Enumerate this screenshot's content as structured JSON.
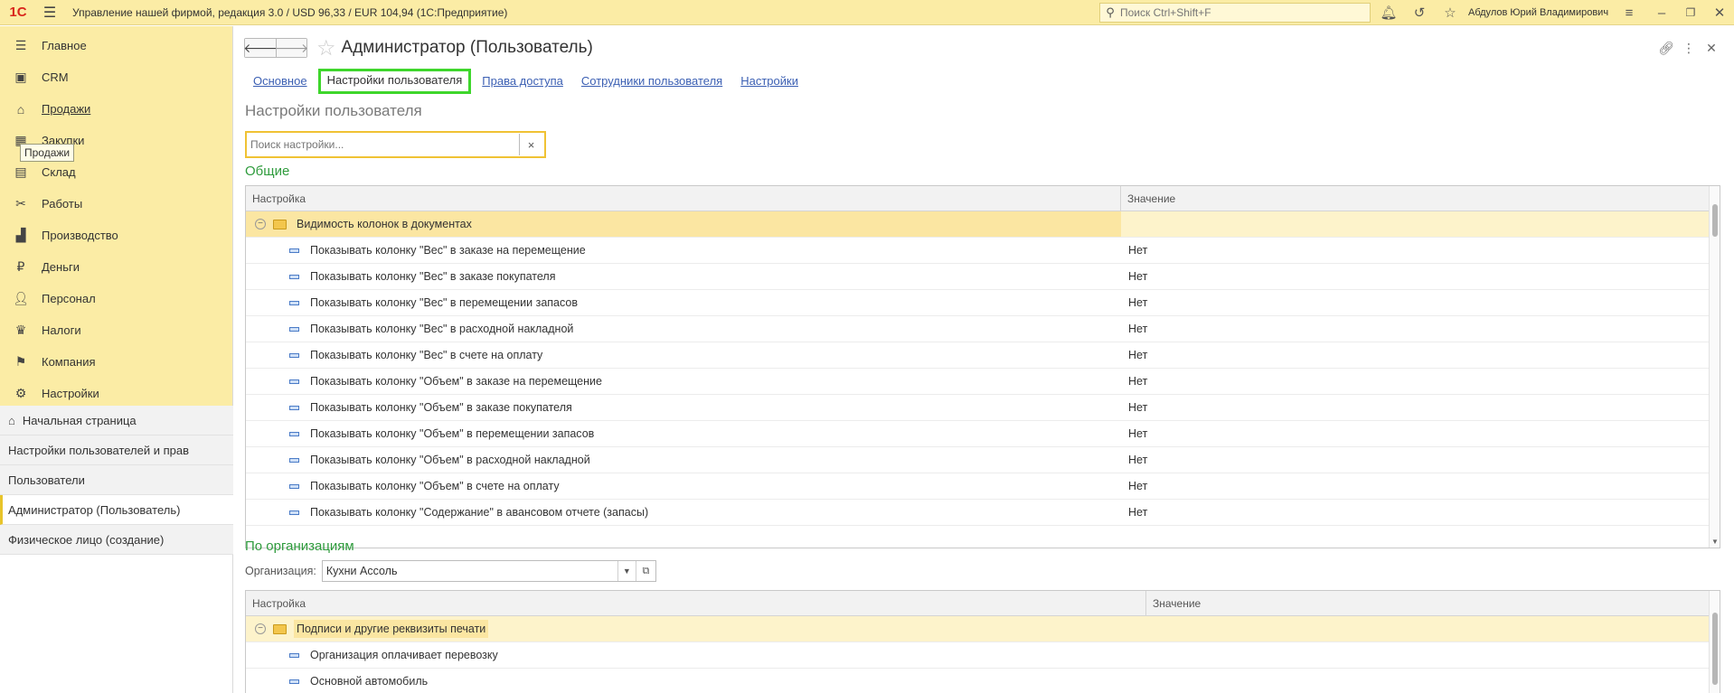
{
  "topbar": {
    "logo": "1С",
    "title": "Управление нашей фирмой, редакция 3.0 / USD 96,33 / EUR 104,94  (1С:Предприятие)",
    "search_placeholder": "Поиск Ctrl+Shift+F",
    "user": "Абдулов Юрий Владимирович"
  },
  "sidebar": {
    "sections": [
      {
        "label": "Главное",
        "icon": "menu-icon"
      },
      {
        "label": "CRM",
        "icon": "crm-icon"
      },
      {
        "label": "Продажи",
        "icon": "sales-icon"
      },
      {
        "label": "Закупки",
        "icon": "purchases-icon"
      },
      {
        "label": "Склад",
        "icon": "warehouse-icon"
      },
      {
        "label": "Работы",
        "icon": "tools-icon"
      },
      {
        "label": "Производство",
        "icon": "factory-icon"
      },
      {
        "label": "Деньги",
        "icon": "money-icon"
      },
      {
        "label": "Персонал",
        "icon": "people-icon"
      },
      {
        "label": "Налоги",
        "icon": "eagle-icon"
      },
      {
        "label": "Компания",
        "icon": "flag-icon"
      },
      {
        "label": "Настройки",
        "icon": "gear-icon"
      }
    ],
    "tooltip": "Продажи",
    "open_windows": [
      {
        "label": "Начальная страница"
      },
      {
        "label": "Настройки пользователей и прав"
      },
      {
        "label": "Пользователи"
      },
      {
        "label": "Администратор (Пользователь)"
      },
      {
        "label": "Физическое лицо (создание)"
      }
    ]
  },
  "form": {
    "title": "Администратор (Пользователь)",
    "tabs": [
      {
        "label": "Основное"
      },
      {
        "label": "Настройки пользователя"
      },
      {
        "label": "Права доступа"
      },
      {
        "label": "Сотрудники пользователя"
      },
      {
        "label": "Настройки"
      }
    ],
    "section_title": "Настройки пользователя",
    "filter_placeholder": "Поиск настройки...",
    "filter_clear": "×"
  },
  "general": {
    "title": "Общие",
    "col_setting": "Настройка",
    "col_value": "Значение",
    "group": "Видимость колонок в документах",
    "rows": [
      {
        "name": "Показывать колонку \"Вес\" в заказе на перемещение",
        "value": "Нет"
      },
      {
        "name": "Показывать колонку \"Вес\" в заказе покупателя",
        "value": "Нет"
      },
      {
        "name": "Показывать колонку \"Вес\" в перемещении запасов",
        "value": "Нет"
      },
      {
        "name": "Показывать колонку \"Вес\" в расходной накладной",
        "value": "Нет"
      },
      {
        "name": "Показывать колонку \"Вес\" в счете на оплату",
        "value": "Нет"
      },
      {
        "name": "Показывать колонку \"Объем\" в заказе на перемещение",
        "value": "Нет"
      },
      {
        "name": "Показывать колонку \"Объем\" в заказе покупателя",
        "value": "Нет"
      },
      {
        "name": "Показывать колонку \"Объем\" в перемещении запасов",
        "value": "Нет"
      },
      {
        "name": "Показывать колонку \"Объем\" в расходной накладной",
        "value": "Нет"
      },
      {
        "name": "Показывать колонку \"Объем\" в счете на оплату",
        "value": "Нет"
      },
      {
        "name": "Показывать колонку \"Содержание\" в авансовом отчете (запасы)",
        "value": "Нет"
      }
    ]
  },
  "by_org": {
    "title": "По организациям",
    "org_label": "Организация:",
    "org_value": "Кухни Ассоль",
    "col_setting": "Настройка",
    "col_value": "Значение",
    "group": "Подписи и другие реквизиты печати",
    "rows": [
      {
        "name": "Организация оплачивает перевозку",
        "value": ""
      },
      {
        "name": "Основной автомобиль",
        "value": ""
      }
    ]
  },
  "colors": {
    "topbar": "#fbeca5",
    "active_tab_border": "#3ed62c",
    "group_green": "#2e9b3c",
    "link_blue": "#3b5fb3"
  }
}
